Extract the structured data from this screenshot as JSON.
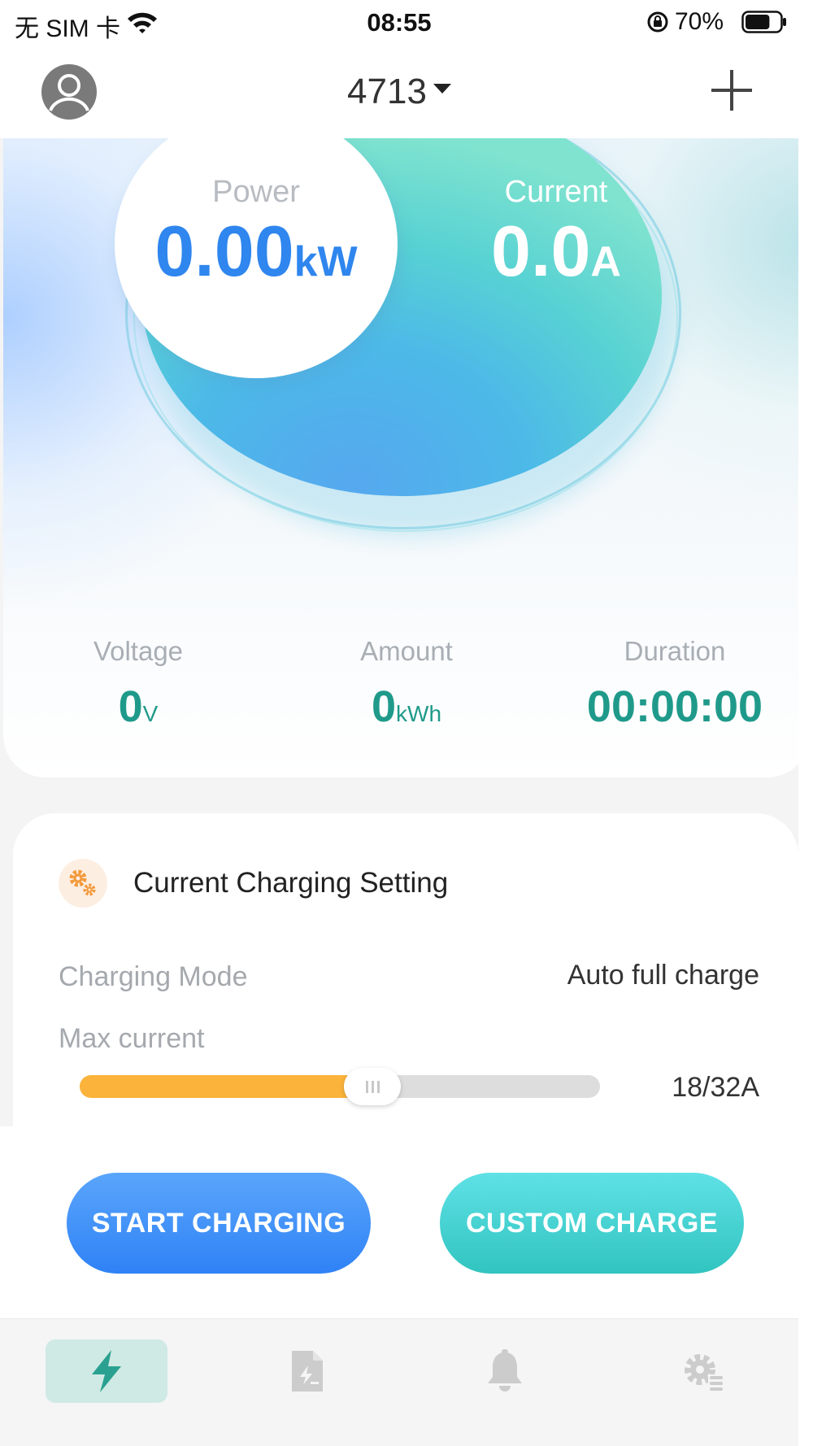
{
  "status_bar": {
    "carrier": "无 SIM 卡",
    "time": "08:55",
    "battery_percent": "70%",
    "battery_level": 0.7
  },
  "header": {
    "device_name": "4713",
    "avatar_icon": "user-avatar-icon",
    "add_icon": "plus-icon"
  },
  "dashboard": {
    "power": {
      "label": "Power",
      "value": "0.00",
      "unit": "kW"
    },
    "current": {
      "label": "Current",
      "value": "0.0",
      "unit": "A"
    },
    "voltage": {
      "label": "Voltage",
      "value": "0",
      "unit": "V"
    },
    "amount": {
      "label": "Amount",
      "value": "0",
      "unit": "kWh"
    },
    "duration": {
      "label": "Duration",
      "value": "00:00:00"
    }
  },
  "settings": {
    "title": "Current Charging Setting",
    "icon": "gears-icon",
    "mode_label": "Charging Mode",
    "mode_value": "Auto full charge",
    "max_current_label": "Max current",
    "max_current_value": "18/32A",
    "max_current_amps": 18,
    "max_current_limit": 32
  },
  "actions": {
    "start_label": "START CHARGING",
    "custom_label": "CUSTOM CHARGE"
  },
  "tabs": [
    {
      "name": "charge",
      "icon": "lightning-icon",
      "active": true
    },
    {
      "name": "records",
      "icon": "document-icon",
      "active": false
    },
    {
      "name": "alerts",
      "icon": "bell-icon",
      "active": false
    },
    {
      "name": "settings",
      "icon": "gear-settings-icon",
      "active": false
    }
  ],
  "colors": {
    "primary_blue": "#2f86ee",
    "teal": "#1f9a8a",
    "slider_fill": "#fbb33b",
    "start_button": "#2f82f6",
    "custom_button": "#31c4bf",
    "active_tab": "#cfe9e4"
  }
}
